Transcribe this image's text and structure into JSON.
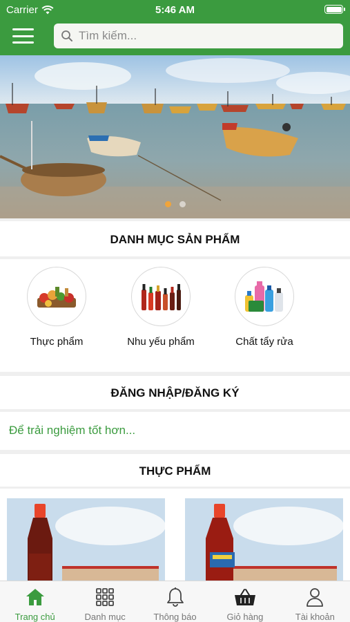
{
  "status_bar": {
    "carrier": "Carrier",
    "time": "5:46 AM"
  },
  "header": {
    "search_placeholder": "Tìm kiếm..."
  },
  "banner": {
    "slide_count": 2,
    "active_slide": 1
  },
  "categories_section": {
    "title": "DANH MỤC SẢN PHẨM",
    "items": [
      {
        "label": "Thực phẩm",
        "icon": "groceries-icon"
      },
      {
        "label": "Nhu yếu phẩm",
        "icon": "sauce-bottles-icon"
      },
      {
        "label": "Chất tẩy rửa",
        "icon": "detergent-icon"
      }
    ]
  },
  "login_section": {
    "title": "ĐĂNG NHẬP/ĐĂNG KÝ",
    "subtitle": "Để trải nghiệm tốt hơn..."
  },
  "food_section": {
    "title": "THỰC PHẨM"
  },
  "tab_bar": {
    "tabs": [
      {
        "label": "Trang chủ",
        "icon": "home-icon",
        "active": true
      },
      {
        "label": "Danh mục",
        "icon": "grid-icon",
        "active": false
      },
      {
        "label": "Thông báo",
        "icon": "bell-icon",
        "active": false
      },
      {
        "label": "Giỏ hàng",
        "icon": "basket-icon",
        "active": false
      },
      {
        "label": "Tài khoản",
        "icon": "user-icon",
        "active": false
      }
    ]
  },
  "colors": {
    "brand_green": "#3b9b3f",
    "active_dot": "#f0a43a"
  }
}
